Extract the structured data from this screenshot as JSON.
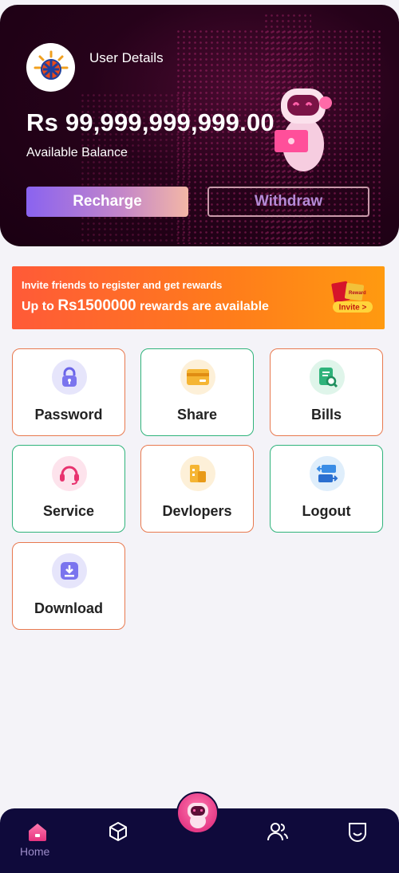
{
  "header": {
    "user_details_label": "User Details",
    "balance": "Rs 99,999,999,999.00",
    "balance_label": "Available Balance",
    "recharge_label": "Recharge",
    "withdraw_label": "Withdraw"
  },
  "invite": {
    "line1": "Invite friends to register and get rewards",
    "line2_prefix": "Up to ",
    "line2_amount": "Rs1500000",
    "line2_suffix": " rewards are available",
    "badge": "Invite >",
    "envelope_text": "Reward"
  },
  "tiles": [
    {
      "label": "Password",
      "icon": "lock-icon"
    },
    {
      "label": "Share",
      "icon": "card-icon"
    },
    {
      "label": "Bills",
      "icon": "bill-search-icon"
    },
    {
      "label": "Service",
      "icon": "headset-icon"
    },
    {
      "label": "Devlopers",
      "icon": "building-icon"
    },
    {
      "label": "Logout",
      "icon": "swap-icon"
    },
    {
      "label": "Download",
      "icon": "download-icon"
    }
  ],
  "nav": {
    "home_label": "Home",
    "items": [
      "home-icon",
      "cube-icon",
      "robot-icon",
      "users-icon",
      "smile-icon"
    ]
  },
  "colors": {
    "header_bg": "#1a0012",
    "accent_orange": "#ff7a1c",
    "tile_border_orange": "#e8794f",
    "tile_border_green": "#2fb37b",
    "nav_bg": "#0f0a3b"
  }
}
